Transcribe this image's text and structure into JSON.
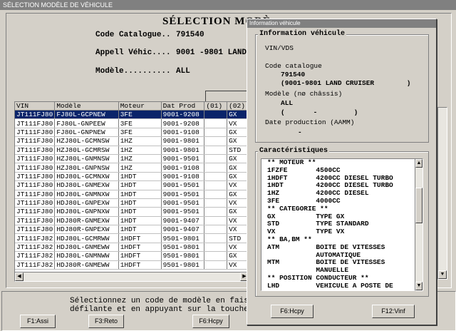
{
  "window": {
    "title": "SÉLECTION MODÈLE DE VÉHICULE"
  },
  "main": {
    "heading": "SÉLECTION MODÈ",
    "code_catalogue_label": "Code Catalogue..",
    "code_catalogue_value": "791540",
    "appell_label": "Appell Véhic....",
    "appell_value": "9001 -9801 LAND",
    "modele_label": "Modèle..........",
    "modele_value": "ALL"
  },
  "table": {
    "columns": [
      "VIN",
      "Modèle",
      "Moteur",
      "Dat Prod",
      "(01)",
      "(02)"
    ],
    "rows": [
      [
        "JT111FJ80",
        "FJ80L-GCPNEW",
        "3FE",
        "9001-9208",
        "",
        "GX"
      ],
      [
        "JT111FJ80",
        "FJ80L-GNPEEW",
        "3FE",
        "9001-9208",
        "",
        "VX"
      ],
      [
        "JT111FJ80",
        "FJ80L-GNPNEW",
        "3FE",
        "9001-9108",
        "",
        "GX"
      ],
      [
        "JT111FJ80",
        "HZJ80L-GCMNSW",
        "1HZ",
        "9001-9801",
        "",
        "GX"
      ],
      [
        "JT111FJ80",
        "HZJ80L-GCMRSW",
        "1HZ",
        "9001-9801",
        "",
        "STD"
      ],
      [
        "JT111FJ80",
        "HZJ80L-GNMNSW",
        "1HZ",
        "9001-9501",
        "",
        "GX"
      ],
      [
        "JT111FJ80",
        "HZJ80L-GNPNSW",
        "1HZ",
        "9001-9108",
        "",
        "GX"
      ],
      [
        "JT111FJ80",
        "HDJ80L-GCMNXW",
        "1HDT",
        "9001-9108",
        "",
        "GX"
      ],
      [
        "JT111FJ80",
        "HDJ80L-GNMEXW",
        "1HDT",
        "9001-9501",
        "",
        "VX"
      ],
      [
        "JT111FJ80",
        "HDJ80L-GNMNXW",
        "1HDT",
        "9001-9501",
        "",
        "GX"
      ],
      [
        "JT111FJ80",
        "HDJ80L-GNPEXW",
        "1HDT",
        "9001-9501",
        "",
        "VX"
      ],
      [
        "JT111FJ80",
        "HDJ80L-GNPNXW",
        "1HDT",
        "9001-9501",
        "",
        "GX"
      ],
      [
        "JT111FJ80",
        "HDJ80R-GNMEXW",
        "1HDT",
        "9001-9407",
        "",
        "VX"
      ],
      [
        "JT111FJ80",
        "HDJ80R-GNPEXW",
        "1HDT",
        "9001-9407",
        "",
        "VX"
      ],
      [
        "JT111FJ82",
        "HDJ80L-GCMRWW",
        "1HDFT",
        "9501-9801",
        "",
        "STD"
      ],
      [
        "JT111FJ82",
        "HDJ80L-GNMEWW",
        "1HDFT",
        "9501-9801",
        "",
        "VX"
      ],
      [
        "JT111FJ82",
        "HDJ80L-GNMNWW",
        "1HDFT",
        "9501-9801",
        "",
        "GX"
      ],
      [
        "JT111FJ82",
        "HDJ80R-GNMEWW",
        "1HDFT",
        "9501-9801",
        "",
        "VX"
      ]
    ],
    "selected_index": 0
  },
  "bottom": {
    "prompt_line1": "Sélectionnez un code de modèle en faisan",
    "prompt_line2": "défilante et en appuyant sur la touche ",
    "buttons": [
      "F1:Assi",
      "F3:Reto",
      "F6:Hcpy"
    ]
  },
  "popup": {
    "title": "Information véhicule",
    "info_group_title": "Information véhicule",
    "vin_label": "VIN/VDS",
    "catalogue_label": "Code catalogue",
    "catalogue_value": "791540",
    "catalogue_range": "(9001-9801 LAND CRUISER        )",
    "modele_label": "Modèle (nø châssis)",
    "modele_value": "ALL",
    "modele_range": "(       -         )",
    "date_label": "Date production (AAMM)",
    "date_value": "-",
    "caract_title": "Caractéristiques",
    "caract_rows": [
      "** MOTEUR **",
      "1FZFE       4500CC",
      "1HDFT       4200CC DIESEL TURBO",
      "1HDT        4200CC DIESEL TURBO",
      "1HZ         4200CC DIESEL",
      "3FE         4000CC",
      "** CATEGORIE **",
      "GX          TYPE GX",
      "STD         TYPE STANDARD",
      "VX          TYPE VX",
      "** BA,BM **",
      "ATM         BOITE DE VITESSES",
      "            AUTOMATIQUE",
      "MTM         BOITE DE VITESSES",
      "            MANUELLE",
      "** POSITION CONDUCTEUR **",
      "LHD         VEHICULE A POSTE DE",
      "            CONDUITE A GAUCHE"
    ],
    "buttons": [
      "F6:Hcpy",
      "F12:Vinf"
    ]
  }
}
